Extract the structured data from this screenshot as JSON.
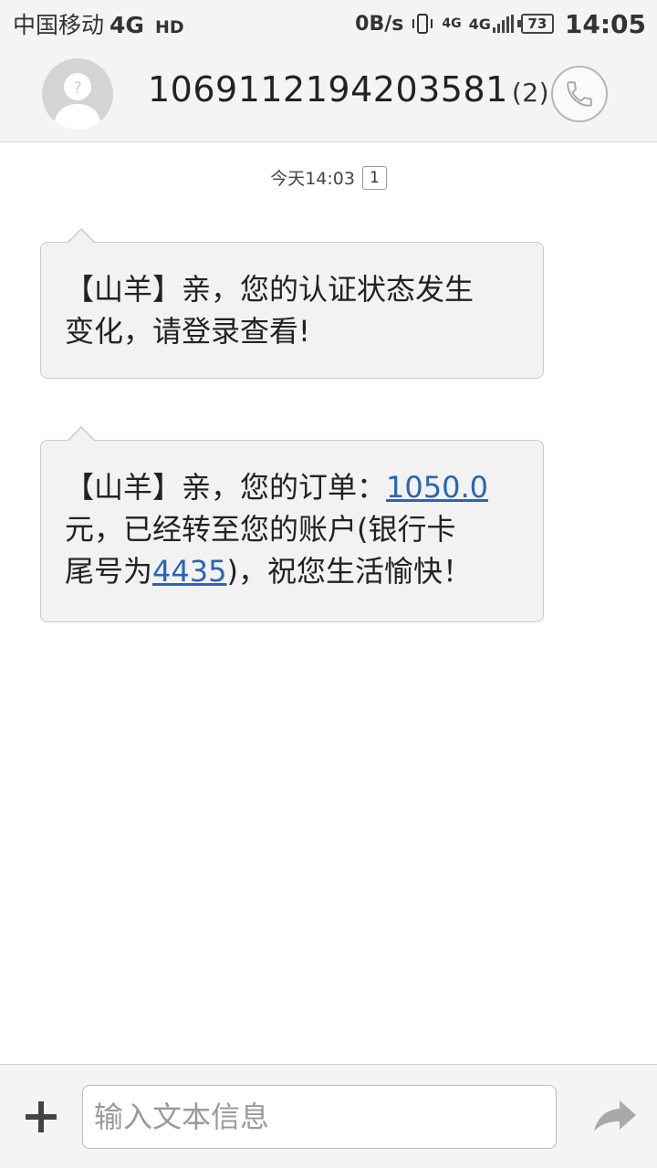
{
  "status_bar": {
    "carrier": "中国移动",
    "network": "4G",
    "hd": "HD",
    "speed": "0B/s",
    "sig_4g_small": "4G",
    "sig_4g": "4G",
    "battery": "73",
    "time": "14:05"
  },
  "header": {
    "contact_number": "1069112194203581",
    "message_count": "(2)"
  },
  "conversation": {
    "timestamp": "今天14:03",
    "sim_slot": "1",
    "messages": [
      {
        "line1": "【山羊】亲，您的认证状态发生",
        "line2": "变化，请登录查看!"
      },
      {
        "line1_text": "【山羊】亲，您的订单：",
        "amount": "1050.0",
        "line2": "元，已经转至您的账户(银行卡",
        "line3_prefix": "尾号为",
        "card_suffix": "4435",
        "line3_suffix": ")，祝您生活愉快！"
      }
    ]
  },
  "input_bar": {
    "placeholder": "输入文本信息"
  },
  "colors": {
    "link": "#2a63b8",
    "bubble_bg": "#f2f2f2",
    "bar_bg": "#f4f4f4"
  }
}
